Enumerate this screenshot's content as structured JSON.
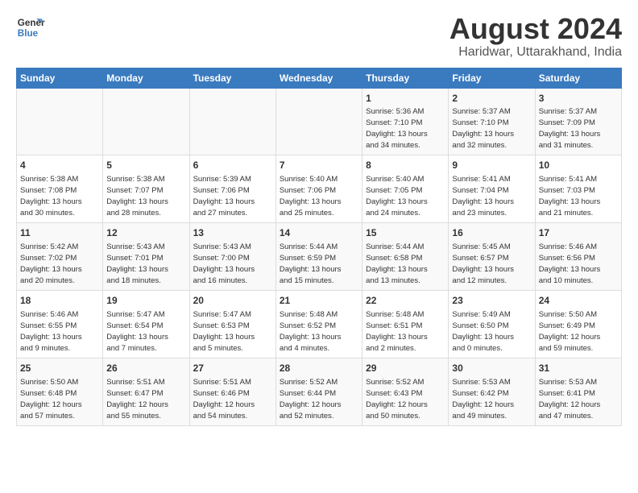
{
  "header": {
    "logo_line1": "General",
    "logo_line2": "Blue",
    "main_title": "August 2024",
    "subtitle": "Haridwar, Uttarakhand, India"
  },
  "weekdays": [
    "Sunday",
    "Monday",
    "Tuesday",
    "Wednesday",
    "Thursday",
    "Friday",
    "Saturday"
  ],
  "weeks": [
    [
      {
        "day": "",
        "info": ""
      },
      {
        "day": "",
        "info": ""
      },
      {
        "day": "",
        "info": ""
      },
      {
        "day": "",
        "info": ""
      },
      {
        "day": "1",
        "info": "Sunrise: 5:36 AM\nSunset: 7:10 PM\nDaylight: 13 hours\nand 34 minutes."
      },
      {
        "day": "2",
        "info": "Sunrise: 5:37 AM\nSunset: 7:10 PM\nDaylight: 13 hours\nand 32 minutes."
      },
      {
        "day": "3",
        "info": "Sunrise: 5:37 AM\nSunset: 7:09 PM\nDaylight: 13 hours\nand 31 minutes."
      }
    ],
    [
      {
        "day": "4",
        "info": "Sunrise: 5:38 AM\nSunset: 7:08 PM\nDaylight: 13 hours\nand 30 minutes."
      },
      {
        "day": "5",
        "info": "Sunrise: 5:38 AM\nSunset: 7:07 PM\nDaylight: 13 hours\nand 28 minutes."
      },
      {
        "day": "6",
        "info": "Sunrise: 5:39 AM\nSunset: 7:06 PM\nDaylight: 13 hours\nand 27 minutes."
      },
      {
        "day": "7",
        "info": "Sunrise: 5:40 AM\nSunset: 7:06 PM\nDaylight: 13 hours\nand 25 minutes."
      },
      {
        "day": "8",
        "info": "Sunrise: 5:40 AM\nSunset: 7:05 PM\nDaylight: 13 hours\nand 24 minutes."
      },
      {
        "day": "9",
        "info": "Sunrise: 5:41 AM\nSunset: 7:04 PM\nDaylight: 13 hours\nand 23 minutes."
      },
      {
        "day": "10",
        "info": "Sunrise: 5:41 AM\nSunset: 7:03 PM\nDaylight: 13 hours\nand 21 minutes."
      }
    ],
    [
      {
        "day": "11",
        "info": "Sunrise: 5:42 AM\nSunset: 7:02 PM\nDaylight: 13 hours\nand 20 minutes."
      },
      {
        "day": "12",
        "info": "Sunrise: 5:43 AM\nSunset: 7:01 PM\nDaylight: 13 hours\nand 18 minutes."
      },
      {
        "day": "13",
        "info": "Sunrise: 5:43 AM\nSunset: 7:00 PM\nDaylight: 13 hours\nand 16 minutes."
      },
      {
        "day": "14",
        "info": "Sunrise: 5:44 AM\nSunset: 6:59 PM\nDaylight: 13 hours\nand 15 minutes."
      },
      {
        "day": "15",
        "info": "Sunrise: 5:44 AM\nSunset: 6:58 PM\nDaylight: 13 hours\nand 13 minutes."
      },
      {
        "day": "16",
        "info": "Sunrise: 5:45 AM\nSunset: 6:57 PM\nDaylight: 13 hours\nand 12 minutes."
      },
      {
        "day": "17",
        "info": "Sunrise: 5:46 AM\nSunset: 6:56 PM\nDaylight: 13 hours\nand 10 minutes."
      }
    ],
    [
      {
        "day": "18",
        "info": "Sunrise: 5:46 AM\nSunset: 6:55 PM\nDaylight: 13 hours\nand 9 minutes."
      },
      {
        "day": "19",
        "info": "Sunrise: 5:47 AM\nSunset: 6:54 PM\nDaylight: 13 hours\nand 7 minutes."
      },
      {
        "day": "20",
        "info": "Sunrise: 5:47 AM\nSunset: 6:53 PM\nDaylight: 13 hours\nand 5 minutes."
      },
      {
        "day": "21",
        "info": "Sunrise: 5:48 AM\nSunset: 6:52 PM\nDaylight: 13 hours\nand 4 minutes."
      },
      {
        "day": "22",
        "info": "Sunrise: 5:48 AM\nSunset: 6:51 PM\nDaylight: 13 hours\nand 2 minutes."
      },
      {
        "day": "23",
        "info": "Sunrise: 5:49 AM\nSunset: 6:50 PM\nDaylight: 13 hours\nand 0 minutes."
      },
      {
        "day": "24",
        "info": "Sunrise: 5:50 AM\nSunset: 6:49 PM\nDaylight: 12 hours\nand 59 minutes."
      }
    ],
    [
      {
        "day": "25",
        "info": "Sunrise: 5:50 AM\nSunset: 6:48 PM\nDaylight: 12 hours\nand 57 minutes."
      },
      {
        "day": "26",
        "info": "Sunrise: 5:51 AM\nSunset: 6:47 PM\nDaylight: 12 hours\nand 55 minutes."
      },
      {
        "day": "27",
        "info": "Sunrise: 5:51 AM\nSunset: 6:46 PM\nDaylight: 12 hours\nand 54 minutes."
      },
      {
        "day": "28",
        "info": "Sunrise: 5:52 AM\nSunset: 6:44 PM\nDaylight: 12 hours\nand 52 minutes."
      },
      {
        "day": "29",
        "info": "Sunrise: 5:52 AM\nSunset: 6:43 PM\nDaylight: 12 hours\nand 50 minutes."
      },
      {
        "day": "30",
        "info": "Sunrise: 5:53 AM\nSunset: 6:42 PM\nDaylight: 12 hours\nand 49 minutes."
      },
      {
        "day": "31",
        "info": "Sunrise: 5:53 AM\nSunset: 6:41 PM\nDaylight: 12 hours\nand 47 minutes."
      }
    ]
  ]
}
